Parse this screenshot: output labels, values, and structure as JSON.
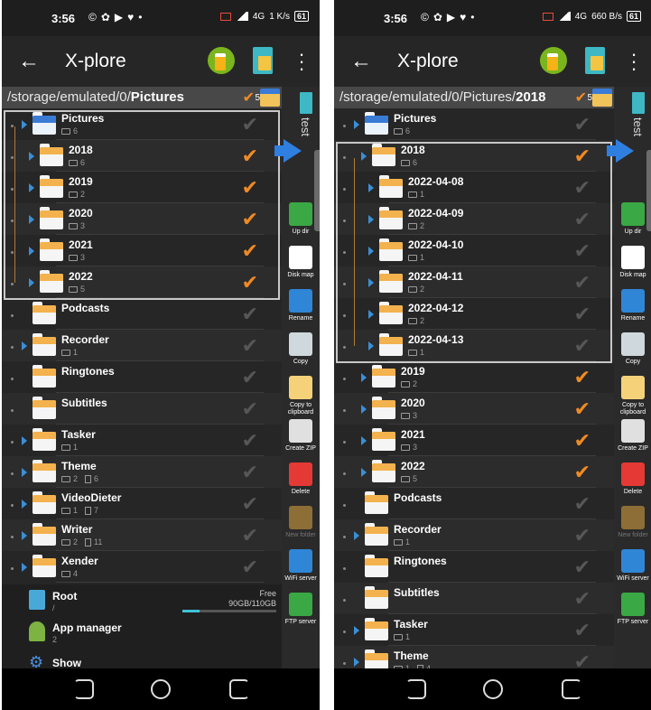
{
  "screens": [
    {
      "status": {
        "time": "3:56",
        "battery": "61",
        "net_left": "4G",
        "net_speed": "1 K/s"
      },
      "app": {
        "title": "X-plore"
      },
      "path": {
        "prefix": "/storage/emulated/0/",
        "current": "Pictures",
        "check_count": "5"
      },
      "side_tab": "test",
      "rows": [
        {
          "name": "Pictures",
          "folders": "6",
          "files": "",
          "checked": false,
          "special": true,
          "arrow": true,
          "level": 0
        },
        {
          "name": "2018",
          "folders": "6",
          "files": "",
          "checked": true,
          "arrow": true,
          "level": 1
        },
        {
          "name": "2019",
          "folders": "2",
          "files": "",
          "checked": true,
          "arrow": true,
          "level": 1
        },
        {
          "name": "2020",
          "folders": "3",
          "files": "",
          "checked": true,
          "arrow": true,
          "level": 1
        },
        {
          "name": "2021",
          "folders": "3",
          "files": "",
          "checked": true,
          "arrow": true,
          "level": 1
        },
        {
          "name": "2022",
          "folders": "5",
          "files": "",
          "checked": true,
          "arrow": true,
          "level": 1
        },
        {
          "name": "Podcasts",
          "folders": "",
          "files": "",
          "checked": false,
          "arrow": false,
          "level": 0
        },
        {
          "name": "Recorder",
          "folders": "1",
          "files": "",
          "checked": false,
          "arrow": true,
          "level": 0
        },
        {
          "name": "Ringtones",
          "folders": "",
          "files": "",
          "checked": false,
          "arrow": false,
          "level": 0
        },
        {
          "name": "Subtitles",
          "folders": "",
          "files": "",
          "checked": false,
          "arrow": false,
          "level": 0
        },
        {
          "name": "Tasker",
          "folders": "1",
          "files": "",
          "checked": false,
          "arrow": true,
          "level": 0
        },
        {
          "name": "Theme",
          "folders": "2",
          "files": "6",
          "checked": false,
          "arrow": true,
          "level": 0
        },
        {
          "name": "VideoDieter",
          "folders": "1",
          "files": "7",
          "checked": false,
          "arrow": true,
          "level": 0
        },
        {
          "name": "Writer",
          "folders": "2",
          "files": "11",
          "checked": false,
          "arrow": true,
          "level": 0
        },
        {
          "name": "Xender",
          "folders": "4",
          "files": "",
          "checked": false,
          "arrow": true,
          "level": 0
        }
      ],
      "root": {
        "name": "Root",
        "path": "/",
        "free_label": "Free",
        "free_size": "90GB/110GB",
        "used_fraction": 0.18
      },
      "app_manager": {
        "name": "App manager",
        "folders": "2"
      },
      "show": {
        "name": "Show"
      },
      "selection_rows": [
        0,
        5
      ]
    },
    {
      "status": {
        "time": "3:56",
        "battery": "61",
        "net_left": "4G",
        "net_speed": "660 B/s"
      },
      "app": {
        "title": "X-plore"
      },
      "path": {
        "prefix": "/storage/emulated/0/Pictures/",
        "current": "2018",
        "check_count": "5"
      },
      "side_tab": "test",
      "rows": [
        {
          "name": "Pictures",
          "folders": "6",
          "files": "",
          "checked": false,
          "special": true,
          "arrow": true,
          "level": 0
        },
        {
          "name": "2018",
          "folders": "6",
          "files": "",
          "checked": true,
          "arrow": true,
          "level": 1
        },
        {
          "name": "2022-04-08",
          "folders": "1",
          "files": "",
          "checked": false,
          "arrow": true,
          "level": 2
        },
        {
          "name": "2022-04-09",
          "folders": "2",
          "files": "",
          "checked": false,
          "arrow": true,
          "level": 2
        },
        {
          "name": "2022-04-10",
          "folders": "1",
          "files": "",
          "checked": false,
          "arrow": true,
          "level": 2
        },
        {
          "name": "2022-04-11",
          "folders": "2",
          "files": "",
          "checked": false,
          "arrow": true,
          "level": 2
        },
        {
          "name": "2022-04-12",
          "folders": "2",
          "files": "",
          "checked": false,
          "arrow": true,
          "level": 2
        },
        {
          "name": "2022-04-13",
          "folders": "1",
          "files": "",
          "checked": false,
          "arrow": true,
          "level": 2
        },
        {
          "name": "2019",
          "folders": "2",
          "files": "",
          "checked": true,
          "arrow": true,
          "level": 1
        },
        {
          "name": "2020",
          "folders": "3",
          "files": "",
          "checked": true,
          "arrow": true,
          "level": 1
        },
        {
          "name": "2021",
          "folders": "3",
          "files": "",
          "checked": true,
          "arrow": true,
          "level": 1
        },
        {
          "name": "2022",
          "folders": "5",
          "files": "",
          "checked": true,
          "arrow": true,
          "level": 1
        },
        {
          "name": "Podcasts",
          "folders": "",
          "files": "",
          "checked": false,
          "arrow": false,
          "level": 0
        },
        {
          "name": "Recorder",
          "folders": "1",
          "files": "",
          "checked": false,
          "arrow": true,
          "level": 0
        },
        {
          "name": "Ringtones",
          "folders": "",
          "files": "",
          "checked": false,
          "arrow": false,
          "level": 0
        },
        {
          "name": "Subtitles",
          "folders": "",
          "files": "",
          "checked": false,
          "arrow": false,
          "level": 0
        },
        {
          "name": "Tasker",
          "folders": "1",
          "files": "",
          "checked": false,
          "arrow": true,
          "level": 0
        },
        {
          "name": "Theme",
          "folders": "1",
          "files": "4",
          "checked": false,
          "arrow": true,
          "level": 0
        }
      ],
      "selection_rows": [
        1,
        7
      ]
    }
  ],
  "tools": [
    {
      "label": "Up dir",
      "icon": "up-arrow-icon",
      "color": "#3aa845",
      "dim": false
    },
    {
      "label": "Disk map",
      "icon": "pie-chart-icon",
      "color": "#ffffff",
      "dim": false
    },
    {
      "label": "Rename",
      "icon": "pencil-icon",
      "color": "#2f86d6",
      "dim": false
    },
    {
      "label": "Copy",
      "icon": "copy-icon",
      "color": "#cfd8dc",
      "dim": false
    },
    {
      "label": "Copy to clipboard",
      "icon": "clipboard-icon",
      "color": "#f5d27a",
      "dim": false
    },
    {
      "label": "Create ZIP",
      "icon": "zip-icon",
      "color": "#e0e0e0",
      "dim": false
    },
    {
      "label": "Delete",
      "icon": "trash-icon",
      "color": "#e53935",
      "dim": false
    },
    {
      "label": "New folder",
      "icon": "new-folder-icon",
      "color": "#8d6e36",
      "dim": true
    },
    {
      "label": "WiFi server",
      "icon": "wifi-icon",
      "color": "#2f86d6",
      "dim": false
    },
    {
      "label": "FTP server",
      "icon": "ftp-icon",
      "color": "#3aa845",
      "dim": false
    }
  ],
  "colors": {
    "check_on": "#f08a24",
    "check_off": "#575757",
    "folder_tab": "#f3b24e",
    "arrow": "#3a8fd8"
  }
}
